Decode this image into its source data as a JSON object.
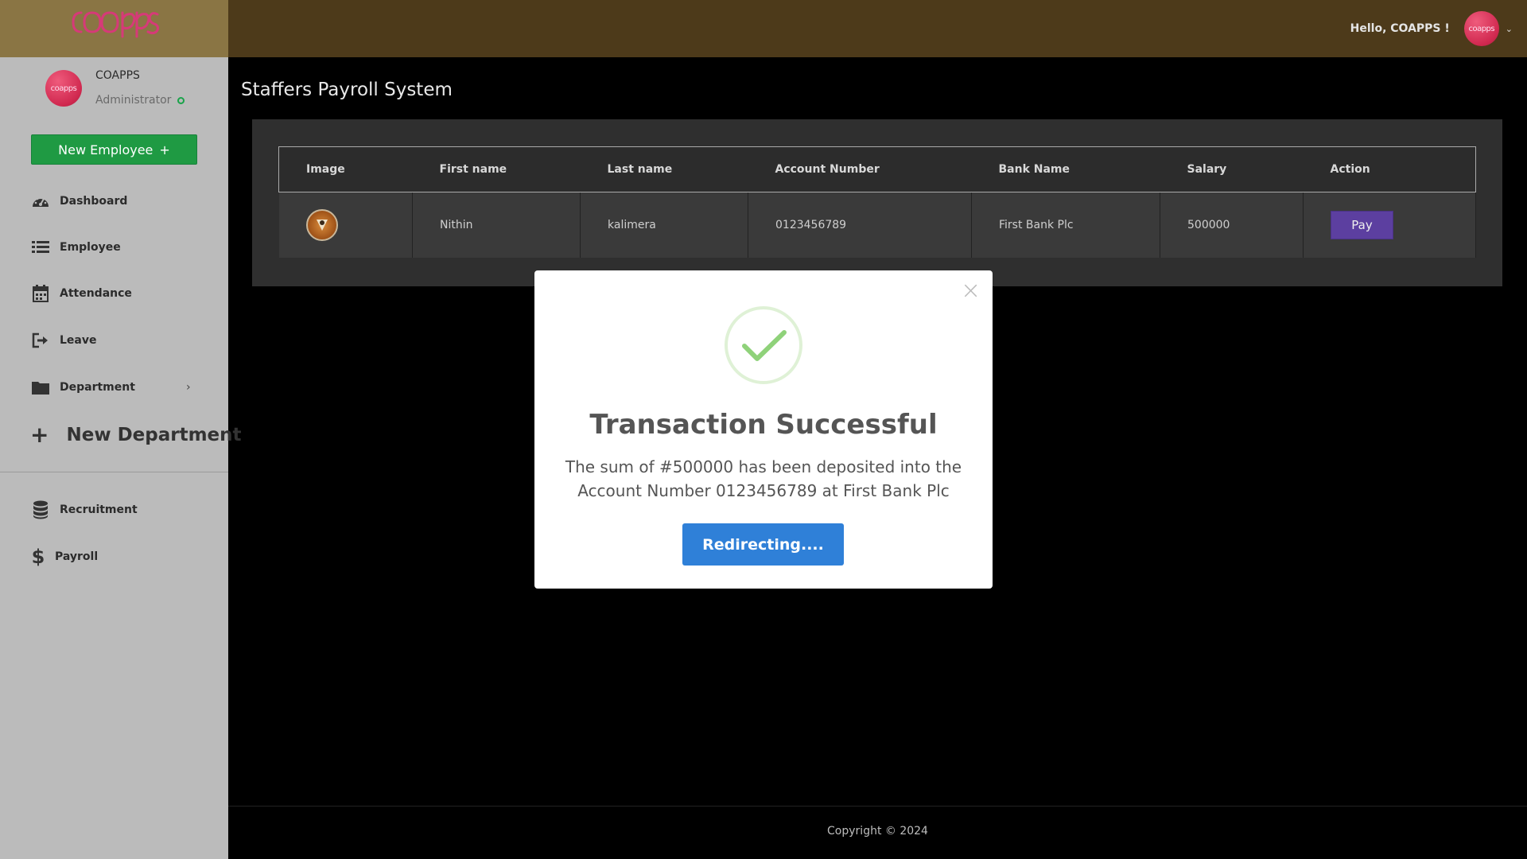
{
  "header": {
    "logo_text": "coapps",
    "greeting": "Hello, COAPPS !",
    "avatar_text": "coapps"
  },
  "sidebar": {
    "profile": {
      "avatar_text": "coapps",
      "name": "COAPPS",
      "role": "Administrator"
    },
    "new_employee_label": "New Employee",
    "items": [
      {
        "label": "Dashboard",
        "icon": "dashboard-gauge-icon"
      },
      {
        "label": "Employee",
        "icon": "list-icon"
      },
      {
        "label": "Attendance",
        "icon": "calendar-icon"
      },
      {
        "label": "Leave",
        "icon": "sign-out-icon"
      },
      {
        "label": "Department",
        "icon": "folder-icon"
      }
    ],
    "new_department_label": "New Department",
    "bottom_items": [
      {
        "label": "Recruitment",
        "icon": "database-icon"
      },
      {
        "label": "Payroll",
        "icon": "dollar-icon"
      }
    ]
  },
  "main": {
    "page_title": "Staffers Payroll System",
    "table": {
      "headers": [
        "Image",
        "First name",
        "Last name",
        "Account Number",
        "Bank Name",
        "Salary",
        "Action"
      ],
      "rows": [
        {
          "first_name": "Nithin",
          "last_name": "kalimera",
          "account_number": "0123456789",
          "bank_name": "First Bank Plc",
          "salary": "500000",
          "action_label": "Pay"
        }
      ]
    }
  },
  "modal": {
    "title": "Transaction Successful",
    "message_line1": "The sum of #500000 has been deposited into the",
    "message_line2": "Account Number 0123456789 at First Bank Plc",
    "button_label": "Redirecting...."
  },
  "footer": {
    "copyright": "Copyright © 2024"
  },
  "colors": {
    "header_bg": "#4d3a1a",
    "logo_bg": "#8a7544",
    "sidebar_bg": "#bbbbbb",
    "primary_green": "#1f9a43",
    "pay_purple": "#5c3fa0",
    "redirect_blue": "#2f80d8",
    "success_green": "#8fd27a"
  }
}
